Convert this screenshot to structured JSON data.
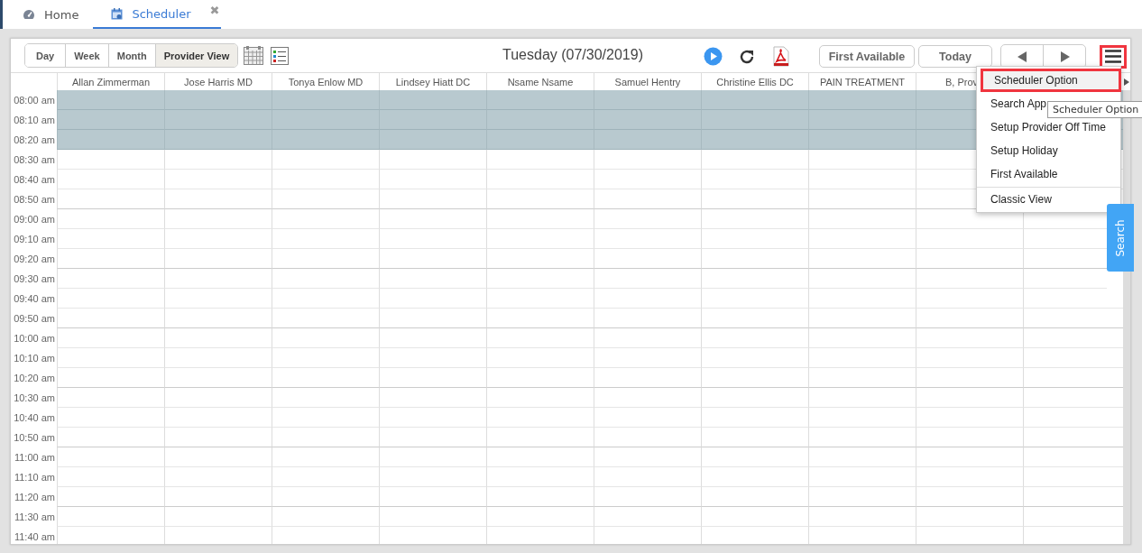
{
  "tabs": [
    {
      "label": "Home",
      "selected": false,
      "kind": "home"
    },
    {
      "label": "Scheduler",
      "selected": true,
      "close": "✖",
      "kind": "calendar"
    }
  ],
  "toolbar": {
    "views": [
      {
        "label": "Day",
        "selected": false
      },
      {
        "label": "Week",
        "selected": false
      },
      {
        "label": "Month",
        "selected": false
      },
      {
        "label": "Provider View",
        "selected": true
      }
    ],
    "date": "Tuesday (07/30/2019)",
    "buttons": [
      "First Available",
      "Today"
    ],
    "menu_highlighted": true
  },
  "providers": [
    "Allan Zimmerman",
    "Jose Harris MD",
    "Tonya Enlow MD",
    "Lindsey Hiatt DC",
    "Nsame Nsame",
    "Samuel Hentry",
    "Christine Ellis DC",
    "PAIN TREATMENT",
    "B, Prov"
  ],
  "time_slots": [
    {
      "label": "08:00 am",
      "blocked": true
    },
    {
      "label": "08:10 am",
      "blocked": true
    },
    {
      "label": "08:20 am",
      "blocked": true
    },
    {
      "label": "08:30 am",
      "blocked": false
    },
    {
      "label": "08:40 am",
      "blocked": false
    },
    {
      "label": "08:50 am",
      "blocked": false
    },
    {
      "label": "09:00 am",
      "blocked": false
    },
    {
      "label": "09:10 am",
      "blocked": false
    },
    {
      "label": "09:20 am",
      "blocked": false
    },
    {
      "label": "09:30 am",
      "blocked": false
    },
    {
      "label": "09:40 am",
      "blocked": false
    },
    {
      "label": "09:50 am",
      "blocked": false
    },
    {
      "label": "10:00 am",
      "blocked": false
    },
    {
      "label": "10:10 am",
      "blocked": false
    },
    {
      "label": "10:20 am",
      "blocked": false
    },
    {
      "label": "10:30 am",
      "blocked": false
    },
    {
      "label": "10:40 am",
      "blocked": false
    },
    {
      "label": "10:50 am",
      "blocked": false
    },
    {
      "label": "11:00 am",
      "blocked": false
    },
    {
      "label": "11:10 am",
      "blocked": false
    },
    {
      "label": "11:20 am",
      "blocked": false
    },
    {
      "label": "11:30 am",
      "blocked": false
    },
    {
      "label": "11:40 am",
      "blocked": false
    }
  ],
  "menu": {
    "items": [
      {
        "label": "Scheduler Option",
        "selected": true,
        "highlighted": true,
        "group_start": false
      },
      {
        "label": "Search App",
        "selected": false,
        "highlighted": false,
        "group_start": false
      },
      {
        "label": "Setup Provider Off Time",
        "selected": false,
        "highlighted": false,
        "group_start": false
      },
      {
        "label": "Setup Holiday",
        "selected": false,
        "highlighted": false,
        "group_start": false
      },
      {
        "label": "First Available",
        "selected": false,
        "highlighted": false,
        "group_start": false
      },
      {
        "label": "Classic View",
        "selected": false,
        "highlighted": false,
        "group_start": true
      }
    ]
  },
  "tooltip": "Scheduler Option",
  "search_tab": "Search"
}
